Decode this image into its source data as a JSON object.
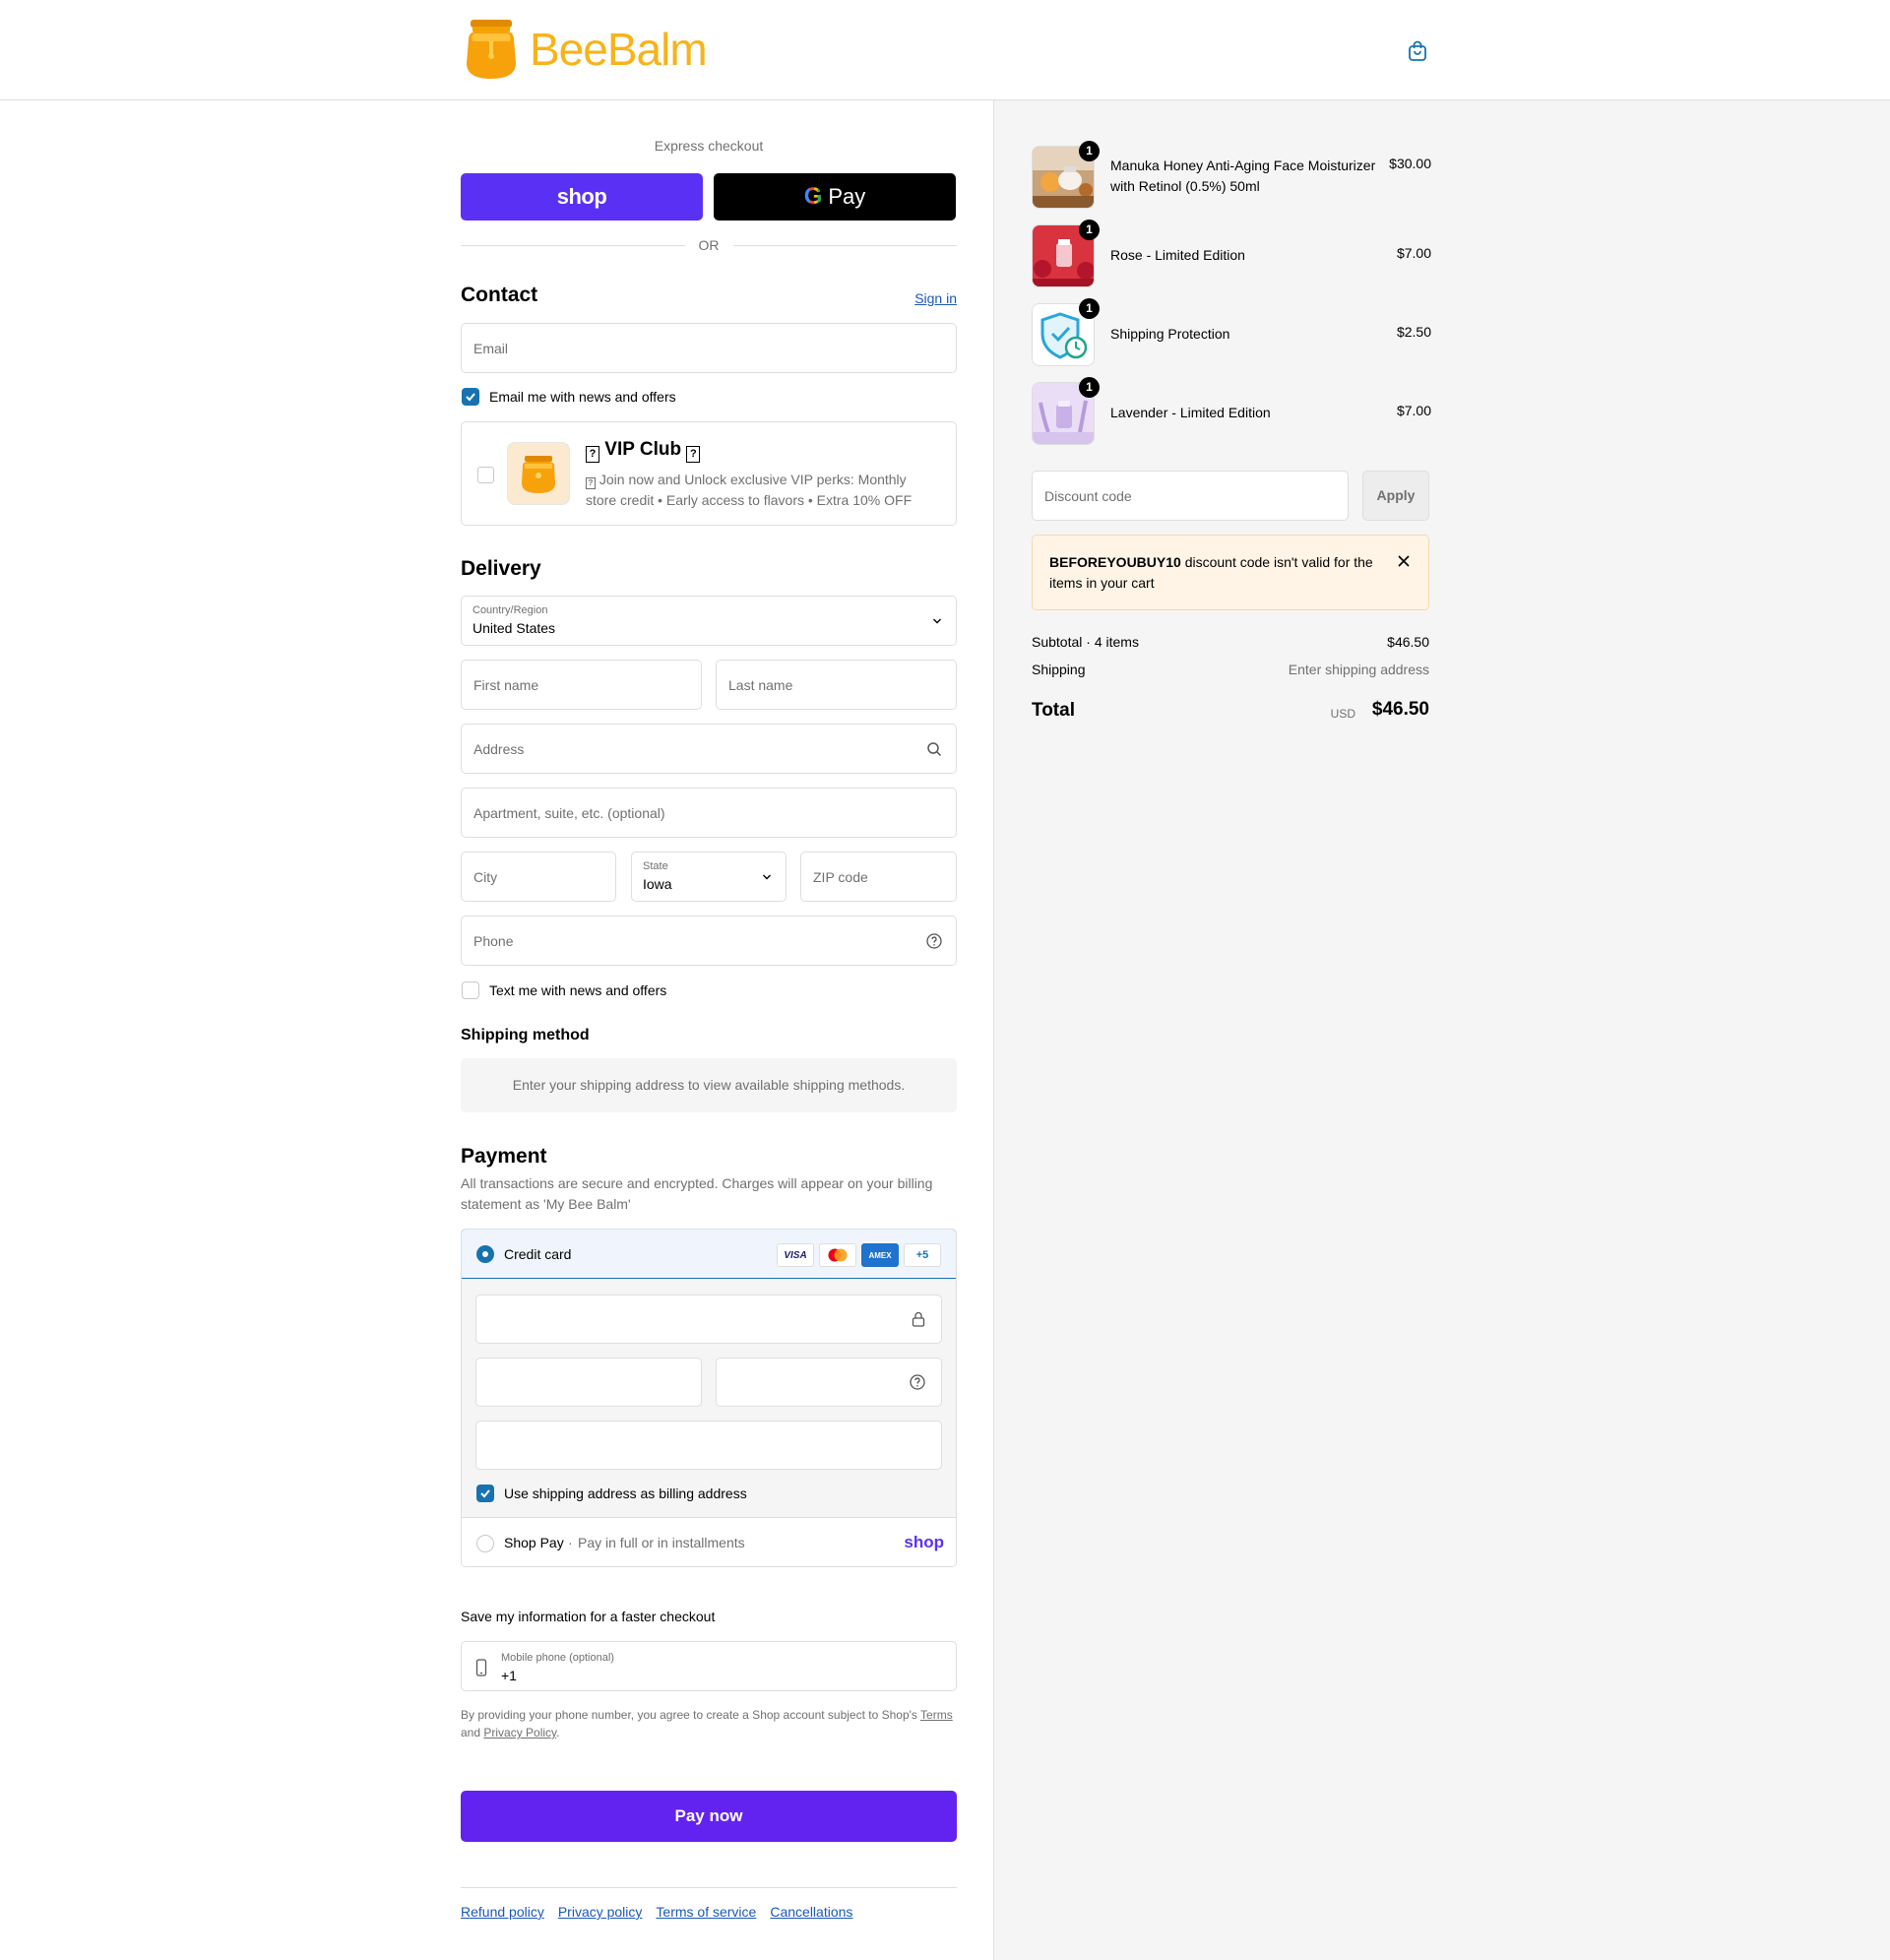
{
  "brand": {
    "name": "BeeBalm"
  },
  "express": {
    "title": "Express checkout",
    "shop_label": "shop",
    "gpay_label": "Pay",
    "or": "OR"
  },
  "contact": {
    "title": "Contact",
    "sign_in": "Sign in",
    "email_placeholder": "Email",
    "news_label": "Email me with news and offers",
    "news_checked": true
  },
  "vip": {
    "title": "VIP Club",
    "description": "Join now and Unlock exclusive VIP perks: Monthly store credit • Early access to flavors • Extra 10% OFF"
  },
  "delivery": {
    "title": "Delivery",
    "country_label": "Country/Region",
    "country_value": "United States",
    "first_name": "First name",
    "last_name": "Last name",
    "address": "Address",
    "apartment": "Apartment, suite, etc. (optional)",
    "city": "City",
    "state_label": "State",
    "state_value": "Iowa",
    "zip": "ZIP code",
    "phone": "Phone",
    "text_label": "Text me with news and offers"
  },
  "shipping_method": {
    "title": "Shipping method",
    "message": "Enter your shipping address to view available shipping methods."
  },
  "payment": {
    "title": "Payment",
    "description": "All transactions are secure and encrypted. Charges will appear on your billing statement as 'My Bee Balm'",
    "credit_card": "Credit card",
    "cards": [
      "VISA",
      "MC",
      "AMEX",
      "+5"
    ],
    "billing_same": "Use shipping address as billing address",
    "shoppay_label": "Shop Pay",
    "shoppay_sep": "·",
    "shoppay_desc": "Pay in full or in installments",
    "shoppay_logo": "shop"
  },
  "save": {
    "title": "Save my information for a faster checkout",
    "mobile_label": "Mobile phone (optional)",
    "mobile_value": "+1",
    "legal_prefix": "By providing your phone number, you agree to create a Shop account subject to Shop's",
    "terms": "Terms",
    "and": "and",
    "privacy": "Privacy Policy",
    "period": "."
  },
  "pay_now": "Pay now",
  "footer": [
    "Refund policy",
    "Privacy policy",
    "Terms of service",
    "Cancellations"
  ],
  "cart": {
    "items": [
      {
        "name": "Manuka Honey Anti-Aging Face Moisturizer with Retinol (0.5%) 50ml",
        "price": "$30.00",
        "qty": "1"
      },
      {
        "name": "Rose - Limited Edition",
        "price": "$7.00",
        "qty": "1"
      },
      {
        "name": "Shipping Protection",
        "price": "$2.50",
        "qty": "1"
      },
      {
        "name": "Lavender - Limited Edition",
        "price": "$7.00",
        "qty": "1"
      }
    ],
    "discount_placeholder": "Discount code",
    "apply": "Apply",
    "alert_code": "BEFOREYOUBUY10",
    "alert_msg": " discount code isn't valid for the items in your cart",
    "subtotal_label": "Subtotal · 4 items",
    "subtotal_value": "$46.50",
    "shipping_label": "Shipping",
    "shipping_value": "Enter shipping address",
    "total_label": "Total",
    "currency": "USD",
    "total_value": "$46.50"
  },
  "colors": {
    "accent": "#1773b0",
    "shop_purple": "#5a31f4",
    "pay_button": "#6223f0",
    "brand_yellow": "#f7b31b"
  }
}
